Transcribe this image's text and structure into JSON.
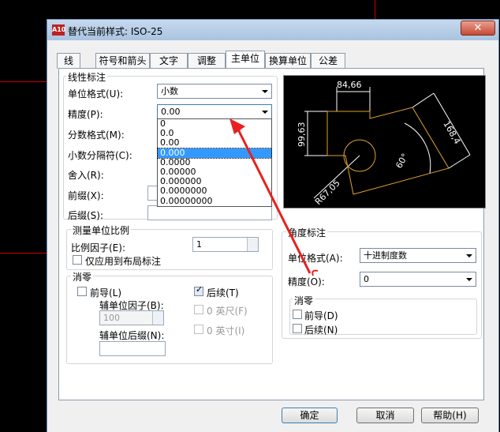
{
  "window": {
    "title": "替代当前样式: ISO-25",
    "close_glyph": "✕",
    "app_icon_text": "A10"
  },
  "tabs": [
    "线",
    "符号和箭头",
    "文字",
    "调整",
    "主单位",
    "换算单位",
    "公差"
  ],
  "linear": {
    "group_title": "线性标注",
    "unit_format_label": "单位格式(U):",
    "unit_format_value": "小数",
    "precision_label": "精度(P):",
    "precision_value": "0.00",
    "precision_options": [
      "0",
      "0.0",
      "0.00",
      "0.000",
      "0.0000",
      "0.00000",
      "0.000000",
      "0.0000000",
      "0.00000000"
    ],
    "precision_highlight": "0.000",
    "fraction_format_label": "分数格式(M):",
    "decimal_sep_label": "小数分隔符(C):",
    "round_label": "舍入(R):",
    "prefix_label": "前缀(X):",
    "suffix_label": "后缀(S):"
  },
  "scale": {
    "group_title": "测量单位比例",
    "factor_label": "比例因子(E):",
    "factor_value": "1",
    "layout_only_label": "仅应用到布局标注"
  },
  "zero_sup": {
    "group_title": "消零",
    "leading_label": "前导(L)",
    "trailing_label": "后续(T)",
    "sub_factor_label": "辅单位因子(B):",
    "sub_factor_value": "100",
    "sub_suffix_label": "辅单位后缀(N):",
    "feet_label": "0 英尺(F)",
    "inches_label": "0 英寸(I)"
  },
  "angular": {
    "group_title": "角度标注",
    "unit_format_label": "单位格式(A):",
    "unit_format_value": "十进制度数",
    "precision_label": "精度(O):",
    "precision_value": "0",
    "zero_title": "消零",
    "leading_label": "前导(D)",
    "trailing_label": "后续(N)"
  },
  "preview": {
    "dim_top": "84,66",
    "dim_left": "99,63",
    "dim_right": "168,4",
    "dim_angle": "60°",
    "dim_radius": "R67,05"
  },
  "buttons": {
    "ok": "确定",
    "cancel": "取消",
    "help": "帮助(H)"
  }
}
